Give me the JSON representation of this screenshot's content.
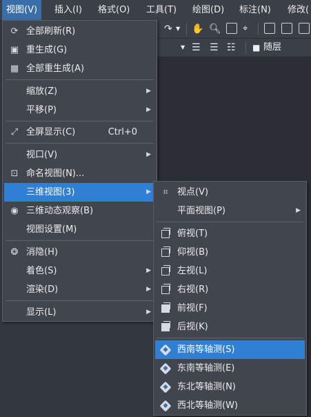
{
  "menubar": {
    "items": [
      {
        "label": "视图(V)"
      },
      {
        "label": "插入(I)"
      },
      {
        "label": "格式(O)"
      },
      {
        "label": "工具(T)"
      },
      {
        "label": "绘图(D)"
      },
      {
        "label": "标注(N)"
      },
      {
        "label": "修改("
      }
    ]
  },
  "toolbar": {
    "layer_label": "随层"
  },
  "view_menu": {
    "items": [
      {
        "label": "全部刷新(R)",
        "icon": "refresh-icon"
      },
      {
        "label": "重生成(G)",
        "icon": "regen-icon"
      },
      {
        "label": "全部重生成(A)",
        "icon": "regen-all-icon"
      },
      {
        "label": "缩放(Z)",
        "submenu": true
      },
      {
        "label": "平移(P)",
        "submenu": true
      },
      {
        "label": "全屏显示(C)",
        "accel": "Ctrl+0",
        "icon": "fullscreen-icon"
      },
      {
        "label": "视口(V)",
        "submenu": true
      },
      {
        "label": "命名视图(N)...",
        "icon": "named-view-icon"
      },
      {
        "label": "三维视图(3)",
        "submenu": true,
        "highlighted": true
      },
      {
        "label": "三维动态观察(B)",
        "icon": "orbit-icon"
      },
      {
        "label": "视图设置(M)"
      },
      {
        "label": "消隐(H)",
        "icon": "hide-icon"
      },
      {
        "label": "着色(S)",
        "submenu": true
      },
      {
        "label": "渲染(D)",
        "submenu": true
      },
      {
        "label": "显示(L)",
        "submenu": true
      }
    ]
  },
  "view3d_menu": {
    "items": [
      {
        "label": "视点(V)",
        "icon": "viewpoint-icon"
      },
      {
        "label": "平面视图(P)",
        "submenu": true
      },
      {
        "label": "俯视(T)",
        "icon": "top-view-icon"
      },
      {
        "label": "仰视(B)",
        "icon": "bottom-view-icon"
      },
      {
        "label": "左视(L)",
        "icon": "left-view-icon"
      },
      {
        "label": "右视(R)",
        "icon": "right-view-icon"
      },
      {
        "label": "前视(F)",
        "icon": "front-view-icon"
      },
      {
        "label": "后视(K)",
        "icon": "back-view-icon"
      },
      {
        "label": "西南等轴测(S)",
        "icon": "sw-iso-icon",
        "highlighted": true
      },
      {
        "label": "东南等轴测(E)",
        "icon": "se-iso-icon"
      },
      {
        "label": "东北等轴测(N)",
        "icon": "ne-iso-icon"
      },
      {
        "label": "西北等轴测(W)",
        "icon": "nw-iso-icon"
      }
    ]
  },
  "colors": {
    "highlight": "#2f80d4",
    "menu_bg": "#41454e",
    "menubar_active": "#3a6ea8"
  }
}
